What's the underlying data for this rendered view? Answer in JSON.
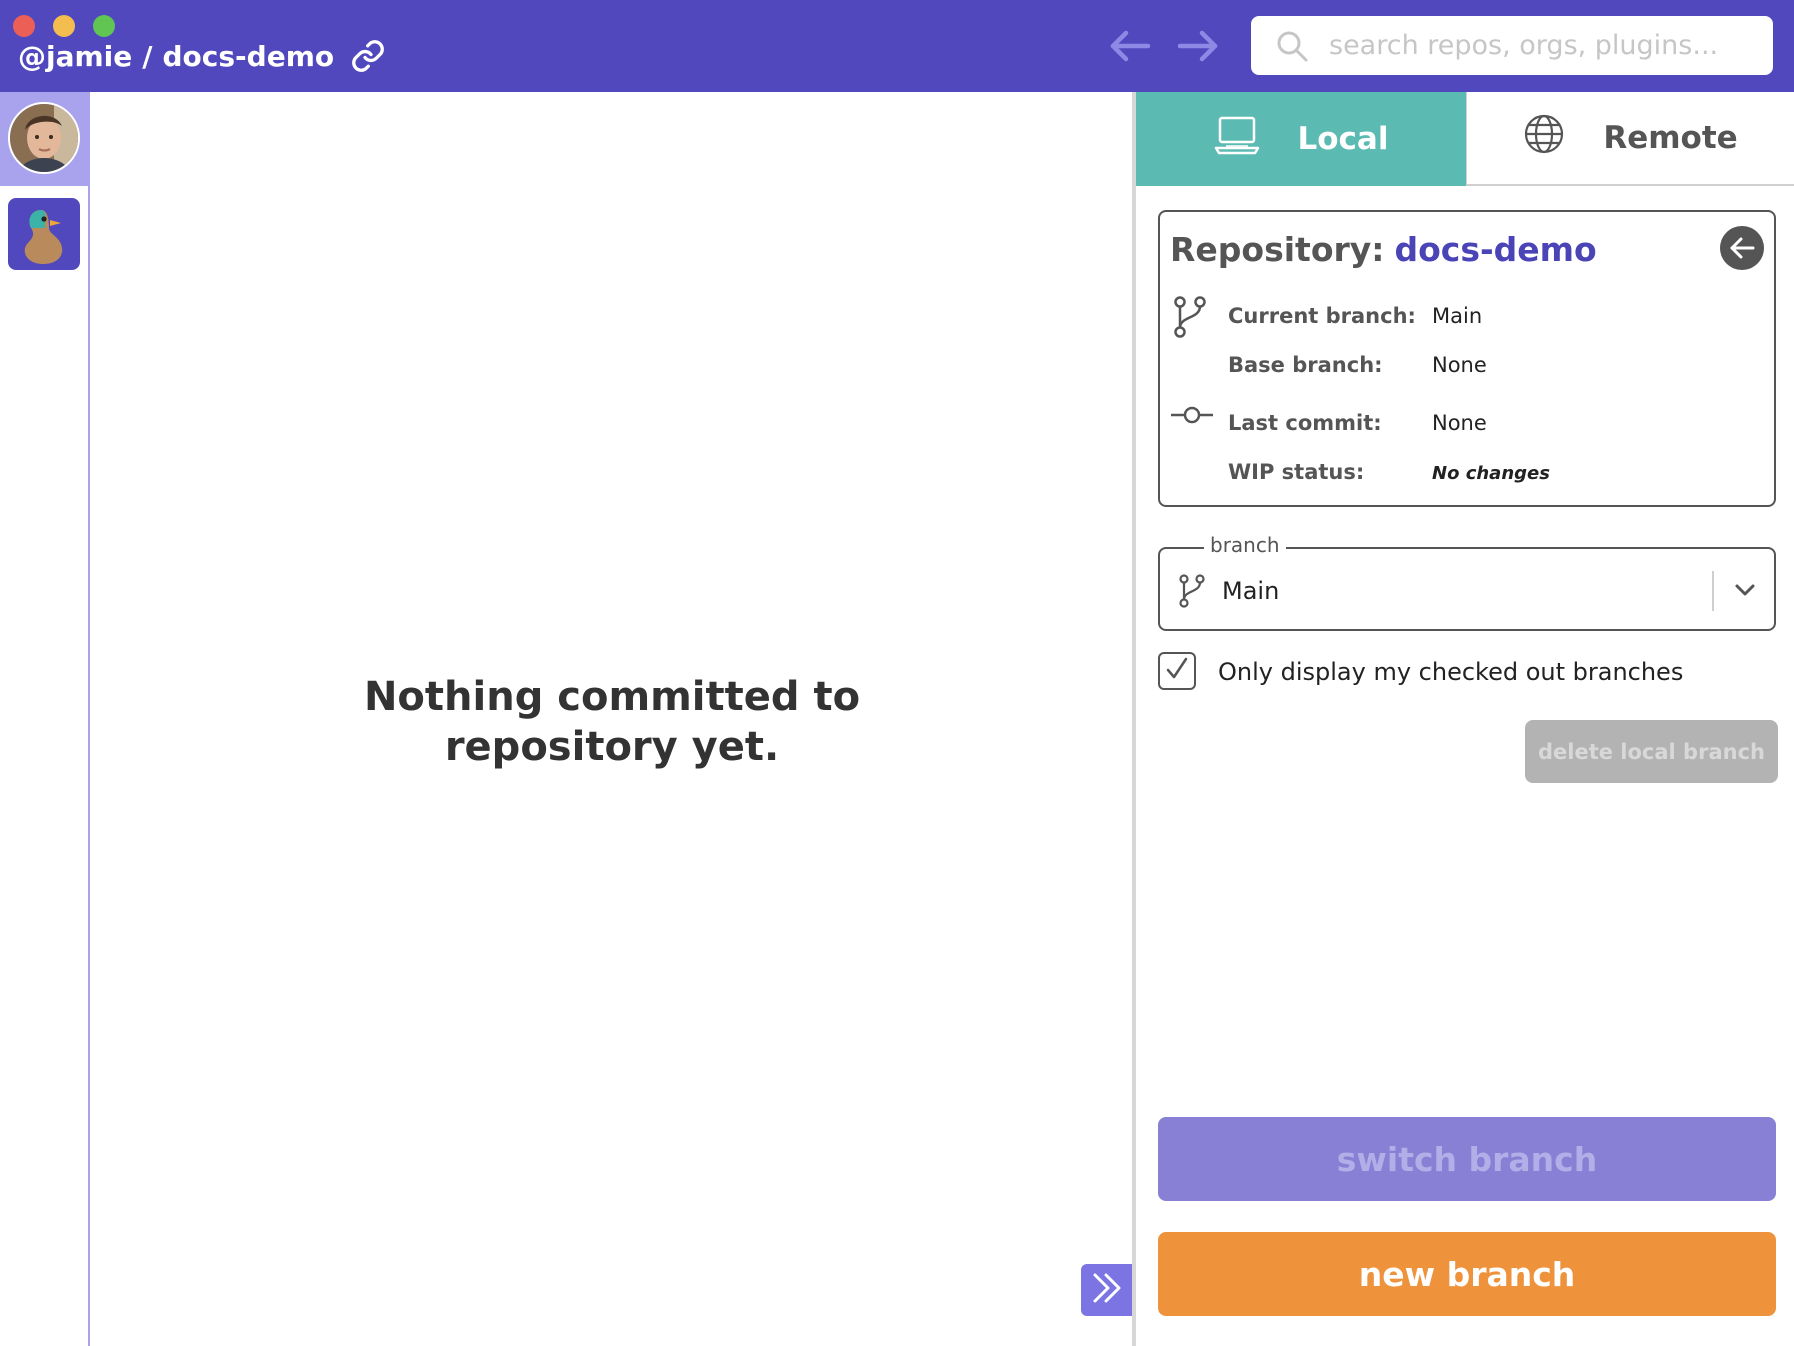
{
  "titlebar": {
    "owner": "@jamie",
    "separator": "/",
    "repo": "docs-demo",
    "link_icon": "link-icon",
    "search_placeholder": "search repos, orgs, plugins..."
  },
  "rail": {
    "items": [
      {
        "name": "user-avatar",
        "active": true
      },
      {
        "name": "duck-app-icon",
        "active": false
      }
    ]
  },
  "main": {
    "empty_message_line1": "Nothing committed to",
    "empty_message_line2": "repository yet."
  },
  "panel": {
    "tabs": [
      {
        "label": "Local",
        "icon": "laptop-icon",
        "active": true
      },
      {
        "label": "Remote",
        "icon": "globe-icon",
        "active": false
      }
    ],
    "repo_card": {
      "title_label": "Repository:",
      "repo_name": "docs-demo",
      "rows": [
        {
          "key": "Current branch:",
          "value": "Main"
        },
        {
          "key": "Base branch:",
          "value": "None"
        },
        {
          "key": "Last commit:",
          "value": "None"
        },
        {
          "key": "WIP status:",
          "value": "No changes"
        }
      ]
    },
    "branch_select": {
      "legend": "branch",
      "value": "Main"
    },
    "only_checked_out": {
      "label": "Only display my checked out branches",
      "checked": true
    },
    "delete_label": "delete local branch",
    "switch_label": "switch branch",
    "new_label": "new branch"
  },
  "colors": {
    "titlebar": "#5148be",
    "rail_active": "#a9a3ee",
    "tab_active": "#5bbab2",
    "repo_name": "#4b44b6",
    "switch_button": "#8780d4",
    "new_button": "#ef923c"
  }
}
